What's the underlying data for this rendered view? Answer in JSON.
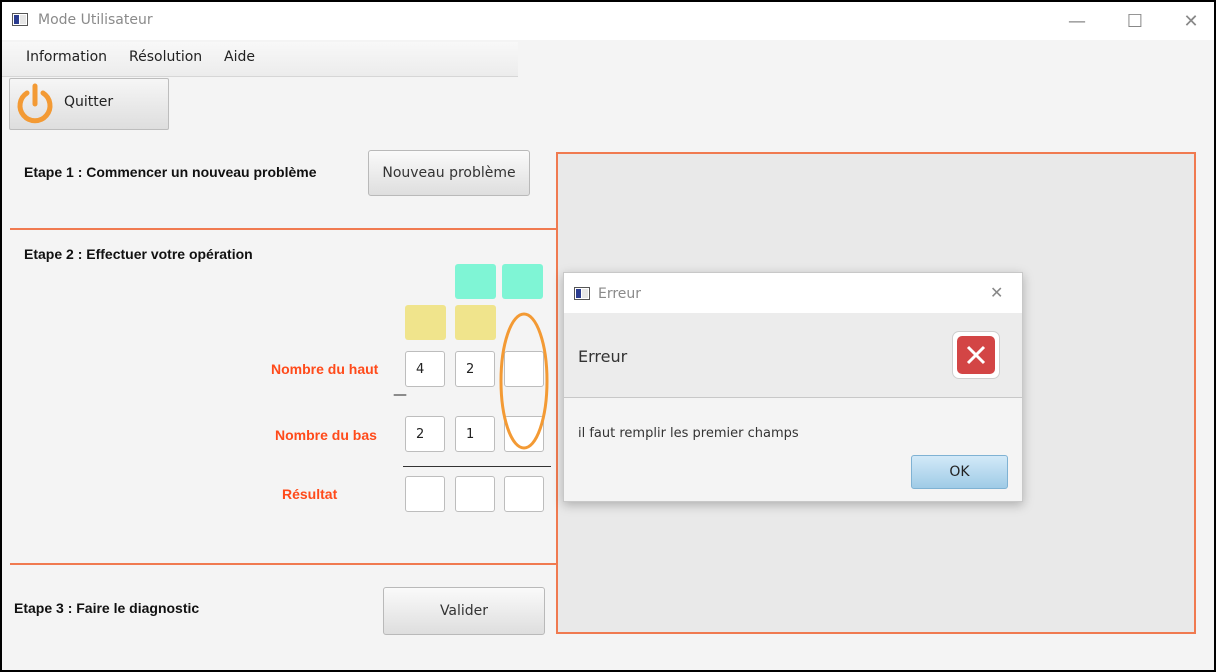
{
  "window": {
    "title": "Mode Utilisateur",
    "minimize_glyph": "—",
    "maximize_glyph": "☐",
    "close_glyph": "✕"
  },
  "menu": {
    "items": [
      "Information",
      "Résolution",
      "Aide"
    ]
  },
  "toolbar": {
    "quit_label": "Quitter",
    "quit_icon": "power-icon",
    "accent_color": "#f39a34"
  },
  "step1": {
    "label": "Etape 1 : Commencer un nouveau problème",
    "button": "Nouveau problème"
  },
  "step2": {
    "label": "Etape 2 : Effectuer votre opération",
    "top_label": "Nombre du haut",
    "operator": "—",
    "bottom_label": "Nombre du bas",
    "result_label": "Résultat",
    "top_values": [
      "4",
      "2",
      ""
    ],
    "bottom_values": [
      "2",
      "1",
      ""
    ],
    "result_values": [
      "",
      "",
      ""
    ]
  },
  "step3": {
    "label": "Etape 3 : Faire le diagnostic",
    "button": "Valider"
  },
  "dialog": {
    "title": "Erreur",
    "header": "Erreur",
    "message": "il faut remplir les premier champs",
    "ok_label": "OK",
    "close_glyph": "✕",
    "icon": "error-icon"
  },
  "colors": {
    "separator": "#f07a50",
    "label_red": "#ff4a1a",
    "carry_green": "#7ff5d5",
    "borrow_yellow": "#f0e48c",
    "annotation_orange": "#f39a34",
    "error_red": "#d34545"
  }
}
